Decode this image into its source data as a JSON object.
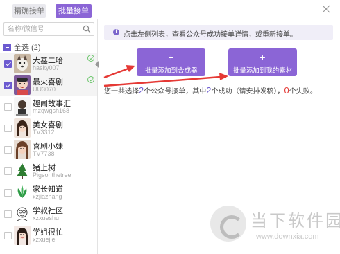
{
  "tabs": {
    "precise": "精确接单",
    "batch": "批量接单"
  },
  "search": {
    "placeholder": "名称/微信号"
  },
  "select_all": {
    "label": "全选 (2)"
  },
  "accounts": [
    {
      "name": "大鑫二哈",
      "id": "hasky007",
      "checked": true,
      "ok": true
    },
    {
      "name": "最火喜剧",
      "id": "UU3070",
      "checked": true,
      "ok": true
    },
    {
      "name": "趣闻故事汇",
      "id": "mzqwgsh168",
      "checked": false,
      "ok": false
    },
    {
      "name": "美女喜剧",
      "id": "TV3312",
      "checked": false,
      "ok": false
    },
    {
      "name": "喜剧小妹",
      "id": "TV7738",
      "checked": false,
      "ok": false
    },
    {
      "name": "猪上树",
      "id": "Pigsonthetree",
      "checked": false,
      "ok": false
    },
    {
      "name": "家长知道",
      "id": "xzjiazhang",
      "checked": false,
      "ok": false
    },
    {
      "name": "学叔社区",
      "id": "xzxueshu",
      "checked": false,
      "ok": false
    },
    {
      "name": "学姐很忙",
      "id": "xzxuejie",
      "checked": false,
      "ok": false
    }
  ],
  "info": {
    "icon_text": "i",
    "text": "点击左侧列表，查看公众号成功接单详情，或重新接单。"
  },
  "actions": {
    "merge_plus": "+",
    "merge_label": "批量添加到合成器",
    "material_plus": "+",
    "material_label": "批量添加到我的素材"
  },
  "summary": {
    "p1": "您一共选择",
    "selected": "2",
    "p2": "个公众号接单，其中",
    "success": "2",
    "p3": "个成功（请安排发稿），",
    "fail": "0",
    "p4": "个失败。"
  },
  "watermark": {
    "title": "当下软件园",
    "url": "www.downxia.com"
  },
  "colors": {
    "accent": "#8b65d6",
    "checkbox": "#6c5bd0",
    "arrow": "#e53935",
    "fail": "#e53935"
  }
}
